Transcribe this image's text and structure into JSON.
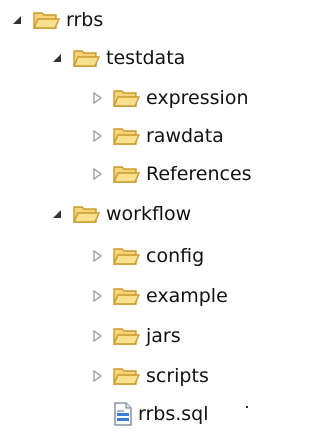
{
  "tree": {
    "root": {
      "label": "rrbs",
      "icon": "folder-open-icon",
      "state": "expanded"
    },
    "testdata": {
      "label": "testdata",
      "icon": "folder-open-icon",
      "state": "expanded"
    },
    "expression": {
      "label": "expression",
      "icon": "folder-icon",
      "state": "collapsed"
    },
    "rawdata": {
      "label": "rawdata",
      "icon": "folder-icon",
      "state": "collapsed"
    },
    "references": {
      "label": "References",
      "icon": "folder-icon",
      "state": "collapsed"
    },
    "workflow": {
      "label": "workflow",
      "icon": "folder-open-icon",
      "state": "expanded"
    },
    "config": {
      "label": "config",
      "icon": "folder-icon",
      "state": "collapsed"
    },
    "example": {
      "label": "example",
      "icon": "folder-icon",
      "state": "collapsed"
    },
    "jars": {
      "label": "jars",
      "icon": "folder-icon",
      "state": "collapsed"
    },
    "scripts": {
      "label": "scripts",
      "icon": "folder-icon",
      "state": "collapsed"
    },
    "sqlfile": {
      "label": "rrbs.sql",
      "icon": "sql-file-icon"
    }
  },
  "colors": {
    "folder_fill": "#f6d27a",
    "folder_stroke": "#c79a2e",
    "expanded_arrow": "#333333",
    "collapsed_arrow": "#9a9a9a",
    "file_blue": "#3a7bd5"
  }
}
